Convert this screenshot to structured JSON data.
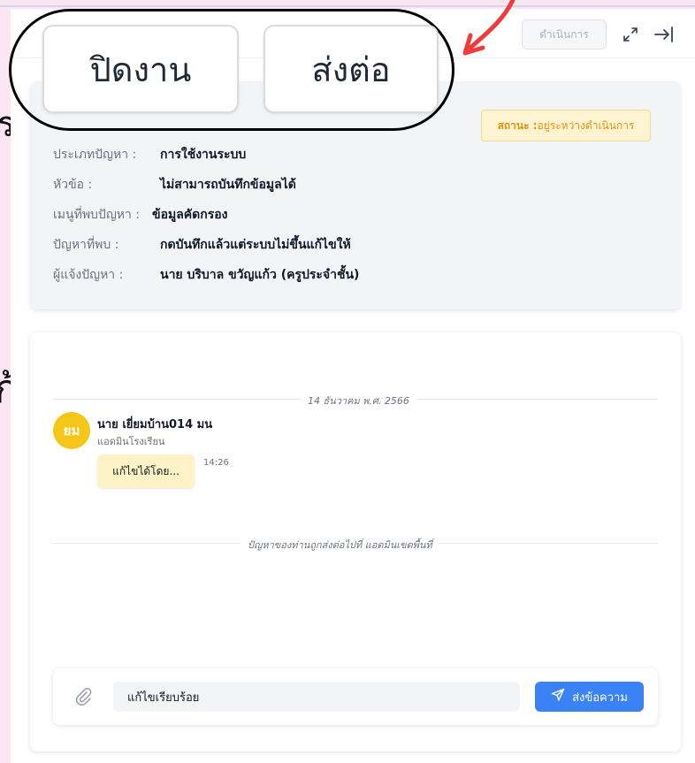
{
  "overlay": {
    "close_label": "ปิดงาน",
    "forward_label": "ส่งต่อ",
    "left_glyph_top": "ร",
    "left_glyph_bottom": "ก้"
  },
  "colors": {
    "accent_blue": "#3b82f6",
    "badge_orange": "#e8920b",
    "avatar_yellow": "#f5c518",
    "arrow_red": "#ef3b3b"
  },
  "toolbar": {
    "status_button_label": "ดำเนินการ",
    "icons": [
      "expand-icon",
      "collapse-right-icon"
    ]
  },
  "ticket": {
    "status_label": "สถานะ :",
    "status_value": "อยู่ระหว่างดำเนินการ",
    "fields": [
      {
        "label": "ประเภทปัญหา :",
        "value": "การใช้งานระบบ"
      },
      {
        "label": "หัวข้อ :",
        "value": "ไม่สามารถบันทึกข้อมูลได้"
      },
      {
        "label": "เมนูที่พบปัญหา :",
        "value": "ข้อมูลคัดกรอง"
      },
      {
        "label": "ปัญหาที่พบ :",
        "value": "กดบันทึกแล้วแต่ระบบไม่ขึ้นแก้ไขให้"
      },
      {
        "label": "ผู้แจ้งปัญหา :",
        "value": "นาย บริบาล ขวัญแก้ว (ครูประจำชั้น)"
      }
    ]
  },
  "chat": {
    "date_divider": "14 ธันวาคม พ.ศ. 2566",
    "messages": [
      {
        "avatar_initials": "ยม",
        "sender": "นาย เยี่ยมบ้าน014 มน",
        "role": "แอดมินโรงเรียน",
        "text": "แก้ไขได้โดย...",
        "time": "14:26"
      }
    ],
    "system_note": "ปัญหาของท่านถูกส่งต่อไปที่ แอดมินเขตพื้นที่"
  },
  "composer": {
    "input_value": "แก้ไขเรียบร้อย",
    "send_label": "ส่งข้อความ",
    "icons": [
      "attach-icon",
      "send-icon"
    ]
  }
}
